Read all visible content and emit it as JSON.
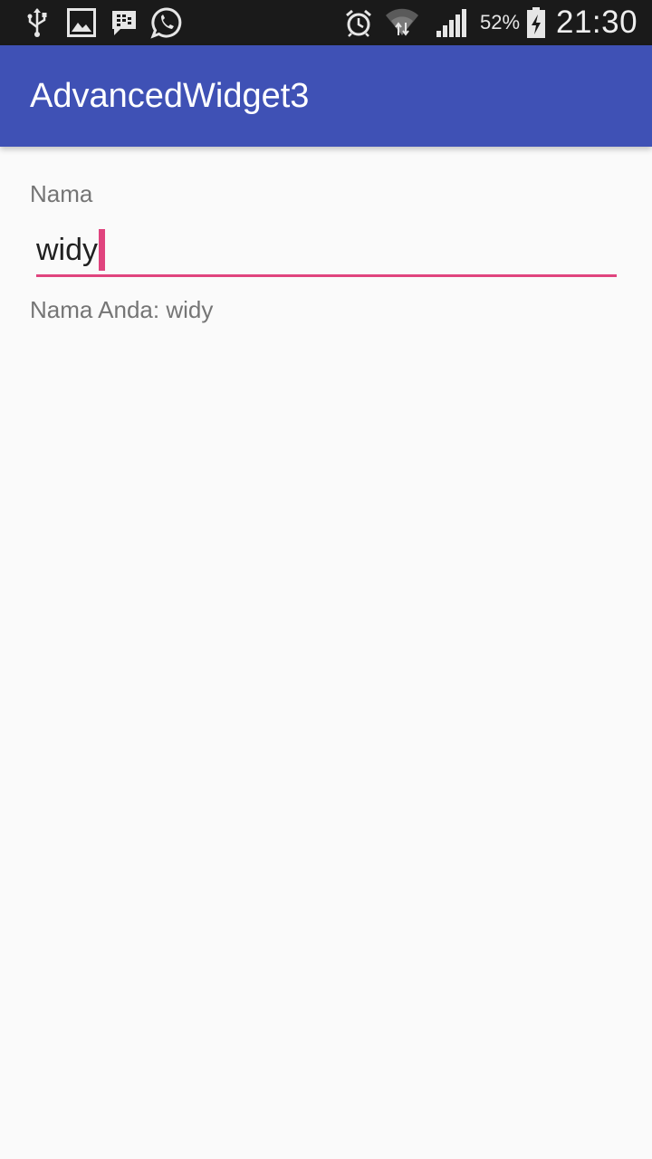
{
  "status_bar": {
    "icons_left": [
      "usb-icon",
      "gallery-icon",
      "bbm-icon",
      "whatsapp-icon"
    ],
    "icons_right": [
      "alarm-icon",
      "wifi-icon",
      "signal-icon",
      "battery-icon"
    ],
    "battery_percent": "52%",
    "time": "21:30"
  },
  "app_bar": {
    "title": "AdvancedWidget3",
    "background_color": "#3f51b5"
  },
  "form": {
    "name_label": "Nama",
    "name_value": "widy",
    "accent_color": "#e0447e"
  },
  "result": {
    "text": "Nama Anda: widy"
  }
}
